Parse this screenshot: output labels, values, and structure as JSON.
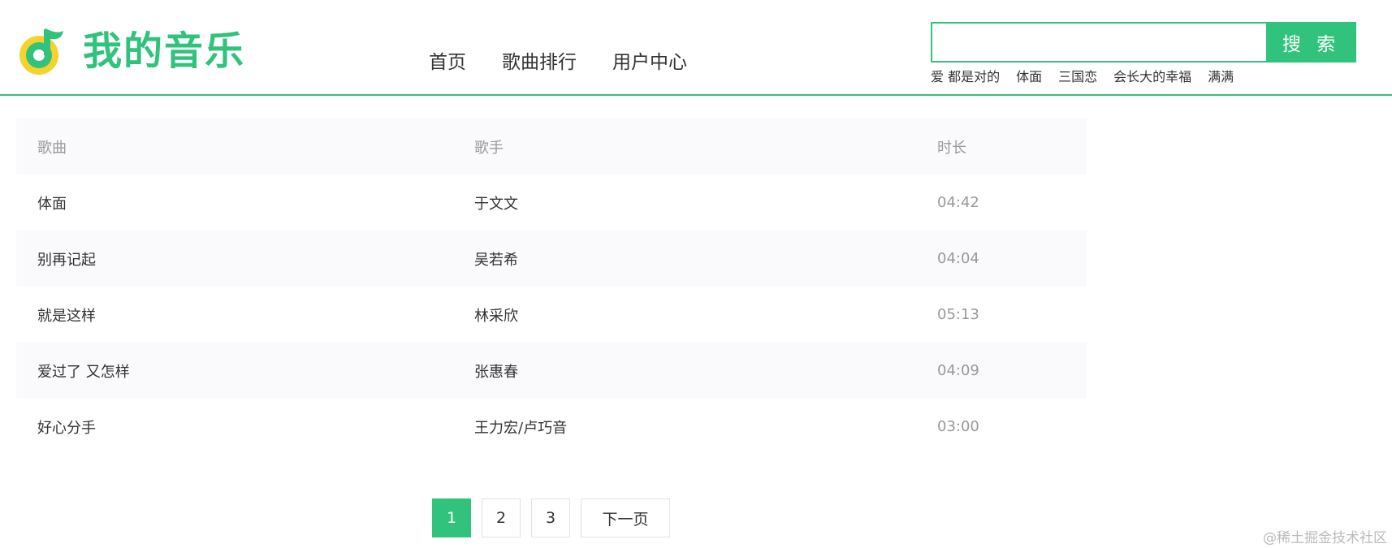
{
  "header": {
    "logo_text": "我的音乐",
    "brand_color": "#31c27c",
    "nav": [
      "首页",
      "歌曲排行",
      "用户中心"
    ],
    "search": {
      "value": "",
      "placeholder": "",
      "button_label": "搜 索"
    },
    "hot_words": [
      "爱 都是对的",
      "体面",
      "三国恋",
      "会长大的幸福",
      "满满"
    ]
  },
  "table": {
    "columns": [
      "歌曲",
      "歌手",
      "时长"
    ],
    "rows": [
      {
        "song": "体面",
        "singer": "于文文",
        "duration": "04:42"
      },
      {
        "song": "别再记起",
        "singer": "吴若希",
        "duration": "04:04"
      },
      {
        "song": "就是这样",
        "singer": "林采欣",
        "duration": "05:13"
      },
      {
        "song": "爱过了 又怎样",
        "singer": "张惠春",
        "duration": "04:09"
      },
      {
        "song": "好心分手",
        "singer": "王力宏/卢巧音",
        "duration": "03:00"
      }
    ]
  },
  "pagination": {
    "pages": [
      "1",
      "2",
      "3"
    ],
    "active_page": "1",
    "next_label": "下一页"
  },
  "watermark": "@稀土掘金技术社区"
}
